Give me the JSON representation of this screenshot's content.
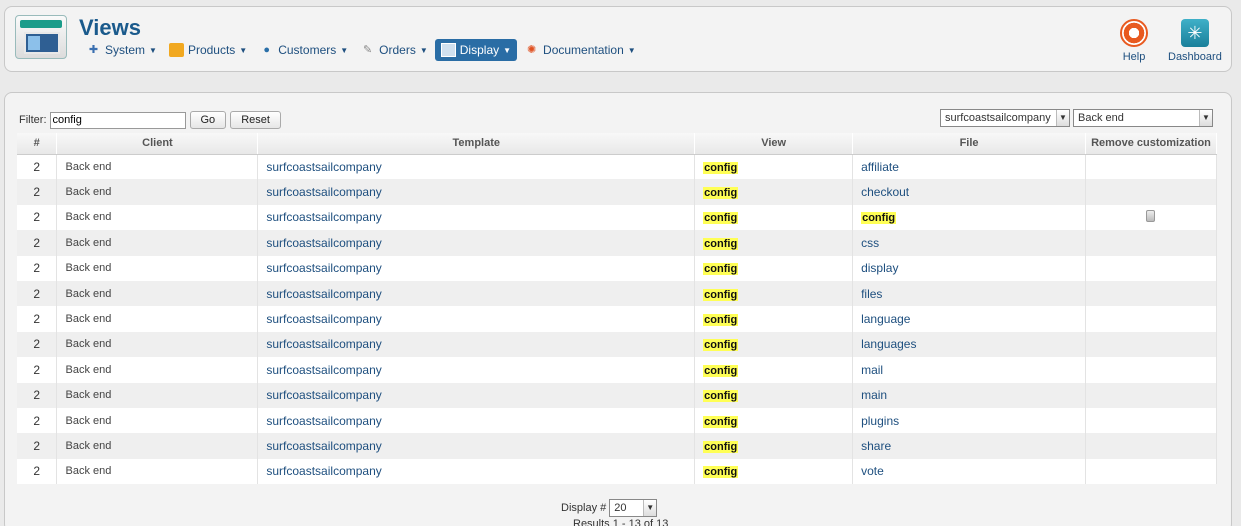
{
  "header": {
    "title": "Views",
    "nav": [
      {
        "label": "System",
        "icon": "wrench-icon"
      },
      {
        "label": "Products",
        "icon": "products-icon"
      },
      {
        "label": "Customers",
        "icon": "customers-icon"
      },
      {
        "label": "Orders",
        "icon": "orders-icon"
      },
      {
        "label": "Display",
        "icon": "display-icon"
      },
      {
        "label": "Documentation",
        "icon": "lifebuoy-icon"
      }
    ],
    "help_label": "Help",
    "dashboard_label": "Dashboard"
  },
  "filter": {
    "label": "Filter:",
    "value": "config",
    "go_label": "Go",
    "reset_label": "Reset",
    "template_select": "surfcoastsailcompany",
    "client_select": "Back end"
  },
  "table": {
    "headers": [
      "#",
      "Client",
      "Template",
      "View",
      "File",
      "Remove customization"
    ],
    "rows": [
      {
        "num": "2",
        "client": "Back end",
        "template": "surfcoastsailcompany",
        "view": "config",
        "file": "affiliate"
      },
      {
        "num": "2",
        "client": "Back end",
        "template": "surfcoastsailcompany",
        "view": "config",
        "file": "checkout"
      },
      {
        "num": "2",
        "client": "Back end",
        "template": "surfcoastsailcompany",
        "view": "config",
        "file": "config"
      },
      {
        "num": "2",
        "client": "Back end",
        "template": "surfcoastsailcompany",
        "view": "config",
        "file": "css"
      },
      {
        "num": "2",
        "client": "Back end",
        "template": "surfcoastsailcompany",
        "view": "config",
        "file": "display"
      },
      {
        "num": "2",
        "client": "Back end",
        "template": "surfcoastsailcompany",
        "view": "config",
        "file": "files"
      },
      {
        "num": "2",
        "client": "Back end",
        "template": "surfcoastsailcompany",
        "view": "config",
        "file": "language"
      },
      {
        "num": "2",
        "client": "Back end",
        "template": "surfcoastsailcompany",
        "view": "config",
        "file": "languages"
      },
      {
        "num": "2",
        "client": "Back end",
        "template": "surfcoastsailcompany",
        "view": "config",
        "file": "mail"
      },
      {
        "num": "2",
        "client": "Back end",
        "template": "surfcoastsailcompany",
        "view": "config",
        "file": "main"
      },
      {
        "num": "2",
        "client": "Back end",
        "template": "surfcoastsailcompany",
        "view": "config",
        "file": "plugins"
      },
      {
        "num": "2",
        "client": "Back end",
        "template": "surfcoastsailcompany",
        "view": "config",
        "file": "share"
      },
      {
        "num": "2",
        "client": "Back end",
        "template": "surfcoastsailcompany",
        "view": "config",
        "file": "vote"
      }
    ]
  },
  "pagination": {
    "display_label": "Display #",
    "display_value": "20",
    "results": "Results 1 - 13 of 13"
  }
}
